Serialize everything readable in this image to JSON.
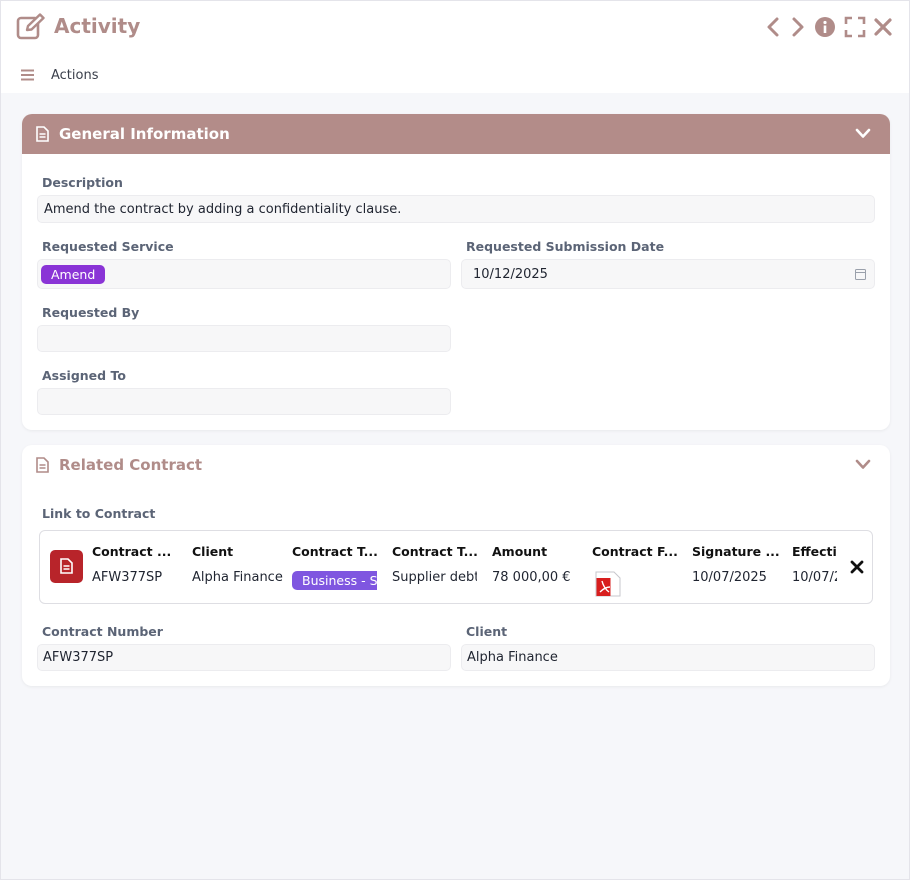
{
  "window": {
    "title": "Activity",
    "actions_label": "Actions",
    "icons": [
      "edit-icon",
      "chevron-left-icon",
      "chevron-right-icon",
      "info-icon",
      "fullscreen-icon",
      "close-icon",
      "menu-icon"
    ]
  },
  "general": {
    "title": "General Information",
    "description_label": "Description",
    "description_value": "Amend the contract by adding a confidentiality clause.",
    "requested_service_label": "Requested Service",
    "requested_service_value": "Amend",
    "submission_date_label": "Requested Submission Date",
    "submission_date_value": "10/12/2025",
    "requested_by_label": "Requested By",
    "requested_by_value": "",
    "assigned_to_label": "Assigned To",
    "assigned_to_value": ""
  },
  "related": {
    "title": "Related Contract",
    "link_label": "Link to Contract",
    "columns": [
      "Contract ...",
      "Client",
      "Contract T...",
      "Contract T...",
      "Amount",
      "Contract F...",
      "Signature ...",
      "Effectiv"
    ],
    "row": {
      "contract_number": "AFW377SP",
      "client": "Alpha Finance",
      "contract_type_tag": "Business - S",
      "contract_type2": "Supplier debt",
      "amount": "78 000,00 €",
      "signature_date": "10/07/2025",
      "effective_date": "10/07/2"
    },
    "contract_number_label": "Contract Number",
    "contract_number_value": "AFW377SP",
    "client_label": "Client",
    "client_value": "Alpha Finance"
  },
  "colors": {
    "accent": "#b38c89",
    "amend_tag": "#8a34d6",
    "type_tag": "#7f56e0",
    "doc_badge": "#b8242a"
  }
}
